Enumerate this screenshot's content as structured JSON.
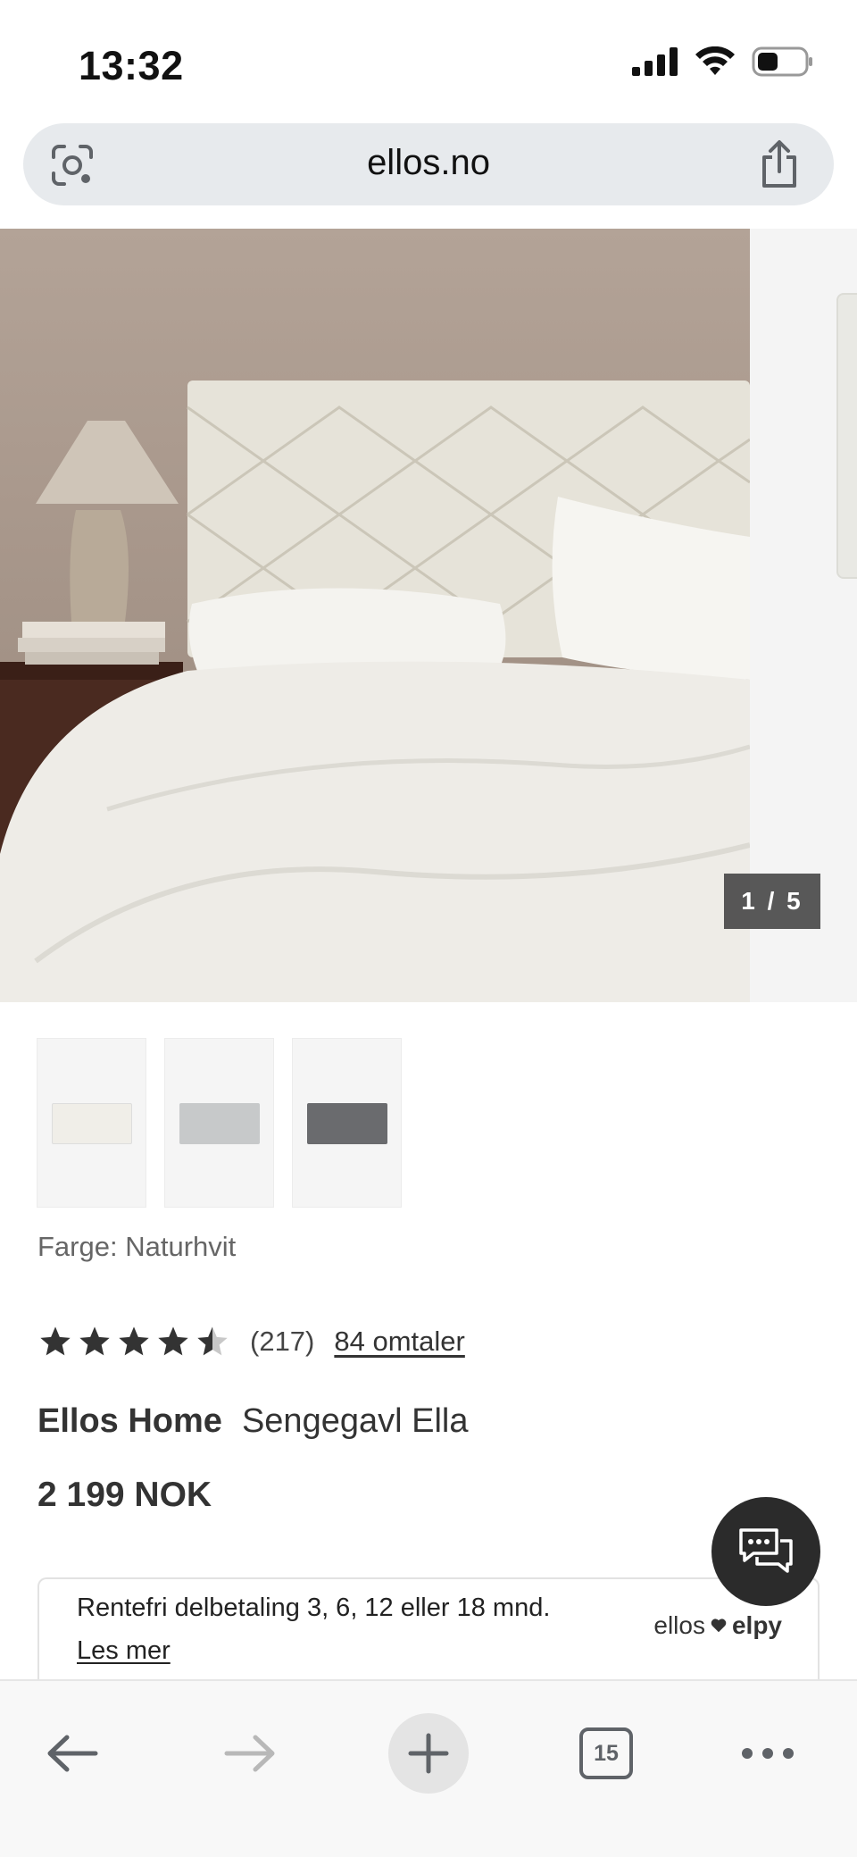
{
  "status": {
    "time": "13:32"
  },
  "browser": {
    "url": "ellos.no",
    "tab_count": "15"
  },
  "gallery": {
    "counter": "1 / 5",
    "thumbnail_colors": [
      "#f0eee8",
      "#c7c9ca",
      "#6a6b6e"
    ]
  },
  "product": {
    "color_label": "Farge: Naturhvit",
    "rating": 4.5,
    "rating_count": "(217)",
    "reviews_link": "84 omtaler",
    "brand": "Ellos Home",
    "name": "Sengegavl Ella",
    "price": "2 199 NOK"
  },
  "financing": {
    "text": "Rentefri delbetaling 3, 6, 12 eller 18 mnd.",
    "link": "Les mer",
    "logo_left": "ellos",
    "logo_right": "elpy"
  },
  "icons": [
    "signal-icon",
    "wifi-icon",
    "battery-icon",
    "lens-icon",
    "share-icon",
    "chat-icon",
    "back-icon",
    "forward-icon",
    "plus-icon",
    "more-icon"
  ]
}
